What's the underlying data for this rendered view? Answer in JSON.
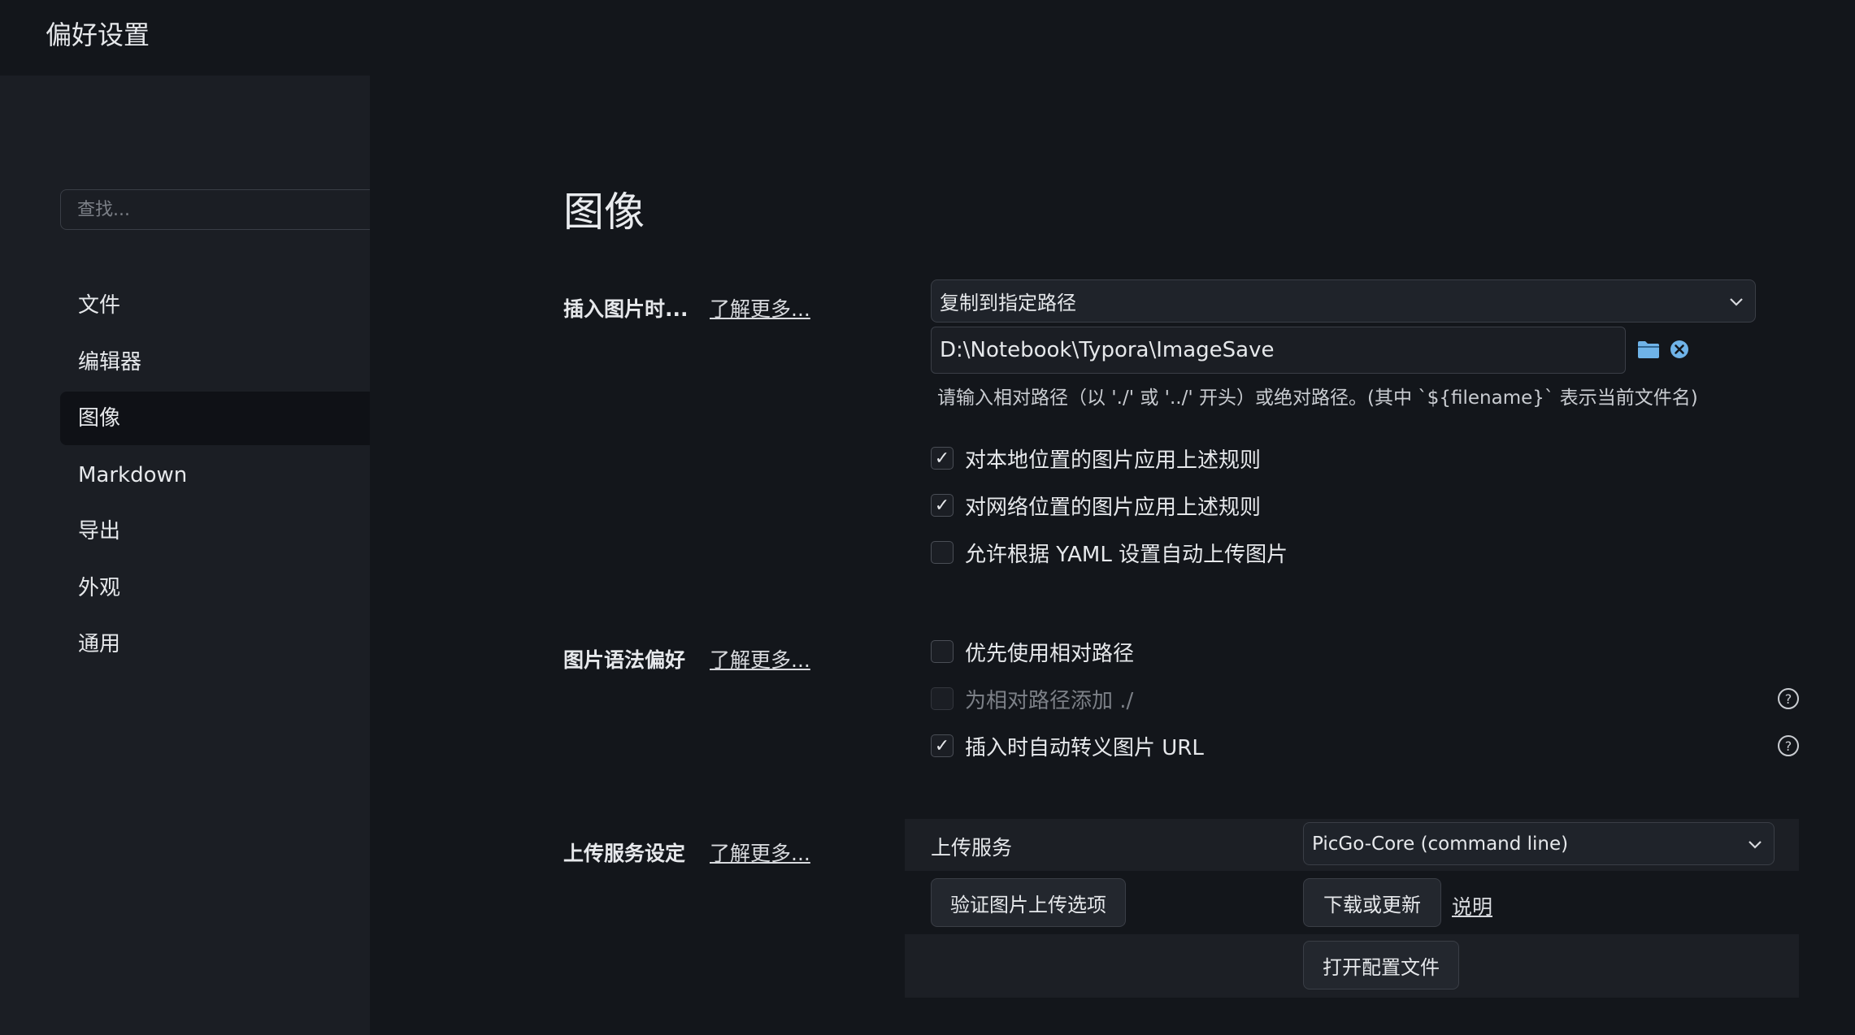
{
  "window": {
    "title": "偏好设置"
  },
  "sidebar": {
    "search_placeholder": "查找...",
    "items": [
      {
        "label": "文件",
        "active": false
      },
      {
        "label": "编辑器",
        "active": false
      },
      {
        "label": "图像",
        "active": true
      },
      {
        "label": "Markdown",
        "active": false
      },
      {
        "label": "导出",
        "active": false
      },
      {
        "label": "外观",
        "active": false
      },
      {
        "label": "通用",
        "active": false
      }
    ]
  },
  "main": {
    "page_title": "图像",
    "insert": {
      "label": "插入图片时...",
      "learn_more": "了解更多...",
      "action_selected": "复制到指定路径",
      "path_value": "D:\\Notebook\\Typora\\ImageSave",
      "hint": "请输入相对路径（以 './' 或 '../' 开头）或绝对路径。(其中 `${filename}` 表示当前文件名)",
      "options": [
        {
          "label": "对本地位置的图片应用上述规则",
          "checked": true,
          "disabled": false
        },
        {
          "label": "对网络位置的图片应用上述规则",
          "checked": true,
          "disabled": false
        },
        {
          "label": "允许根据 YAML 设置自动上传图片",
          "checked": false,
          "disabled": false
        }
      ]
    },
    "syntax": {
      "label": "图片语法偏好",
      "learn_more": "了解更多...",
      "options": [
        {
          "label": "优先使用相对路径",
          "checked": false,
          "disabled": false,
          "help": false
        },
        {
          "label": "为相对路径添加 ./",
          "checked": false,
          "disabled": true,
          "help": true
        },
        {
          "label": "插入时自动转义图片 URL",
          "checked": true,
          "disabled": false,
          "help": true
        }
      ]
    },
    "upload": {
      "label": "上传服务设定",
      "learn_more": "了解更多...",
      "service_label": "上传服务",
      "service_selected": "PicGo-Core (command line)",
      "verify_button": "验证图片上传选项",
      "download_button": "下载或更新",
      "doc_link": "说明",
      "open_config_button": "打开配置文件"
    }
  },
  "icons": {
    "folder": "folder-icon",
    "clear": "clear-icon",
    "help": "help-icon",
    "chevron": "chevron-down-icon"
  },
  "colors": {
    "background": "#13161b",
    "sidebar": "#1b1e24",
    "active_item": "#0f1116",
    "folder_icon": "#6fb3e8"
  }
}
